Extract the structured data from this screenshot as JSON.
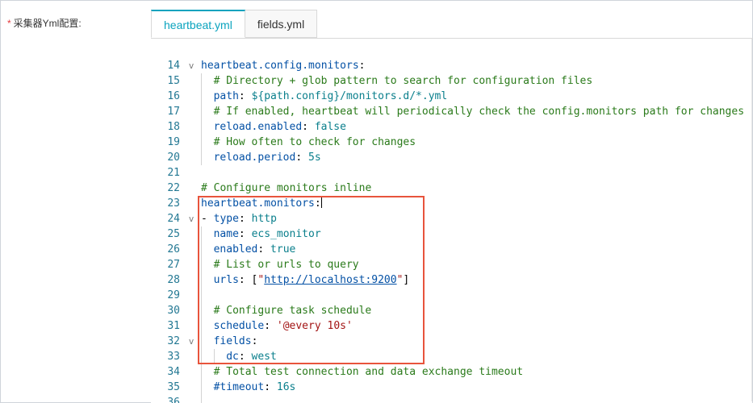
{
  "form": {
    "required_mark": "*",
    "label": "采集器Yml配置:"
  },
  "tabs": [
    {
      "label": "heartbeat.yml",
      "active": true
    },
    {
      "label": "fields.yml",
      "active": false
    }
  ],
  "editor": {
    "lines": [
      {
        "n": "14",
        "fold": "v",
        "indent": 0,
        "tokens": [
          {
            "t": "k",
            "v": "heartbeat.config.monitors"
          },
          {
            "t": "p",
            "v": ":"
          }
        ]
      },
      {
        "n": "15",
        "fold": "",
        "indent": 1,
        "tokens": [
          {
            "t": "c",
            "v": "# Directory + glob pattern to search for configuration files"
          }
        ]
      },
      {
        "n": "16",
        "fold": "",
        "indent": 1,
        "tokens": [
          {
            "t": "k",
            "v": "path"
          },
          {
            "t": "p",
            "v": ": "
          },
          {
            "t": "s",
            "v": "${path.config}/monitors.d/*.yml"
          }
        ]
      },
      {
        "n": "17",
        "fold": "",
        "indent": 1,
        "tokens": [
          {
            "t": "c",
            "v": "# If enabled, heartbeat will periodically check the config.monitors path for changes"
          }
        ]
      },
      {
        "n": "18",
        "fold": "",
        "indent": 1,
        "tokens": [
          {
            "t": "k",
            "v": "reload.enabled"
          },
          {
            "t": "p",
            "v": ": "
          },
          {
            "t": "s",
            "v": "false"
          }
        ]
      },
      {
        "n": "19",
        "fold": "",
        "indent": 1,
        "tokens": [
          {
            "t": "c",
            "v": "# How often to check for changes"
          }
        ]
      },
      {
        "n": "20",
        "fold": "",
        "indent": 1,
        "tokens": [
          {
            "t": "k",
            "v": "reload.period"
          },
          {
            "t": "p",
            "v": ": "
          },
          {
            "t": "s",
            "v": "5s"
          }
        ]
      },
      {
        "n": "21",
        "fold": "",
        "indent": 0,
        "tokens": []
      },
      {
        "n": "22",
        "fold": "",
        "indent": 0,
        "tokens": [
          {
            "t": "c",
            "v": "# Configure monitors inline"
          }
        ]
      },
      {
        "n": "23",
        "fold": "",
        "indent": 0,
        "cursor": true,
        "tokens": [
          {
            "t": "k",
            "v": "heartbeat.monitors"
          },
          {
            "t": "p",
            "v": ":"
          }
        ]
      },
      {
        "n": "24",
        "fold": "v",
        "indent": 0,
        "tokens": [
          {
            "t": "p",
            "v": "- "
          },
          {
            "t": "k",
            "v": "type"
          },
          {
            "t": "p",
            "v": ": "
          },
          {
            "t": "s",
            "v": "http"
          }
        ]
      },
      {
        "n": "25",
        "fold": "",
        "indent": 1,
        "tokens": [
          {
            "t": "k",
            "v": "name"
          },
          {
            "t": "p",
            "v": ": "
          },
          {
            "t": "s",
            "v": "ecs_monitor"
          }
        ]
      },
      {
        "n": "26",
        "fold": "",
        "indent": 1,
        "tokens": [
          {
            "t": "k",
            "v": "enabled"
          },
          {
            "t": "p",
            "v": ": "
          },
          {
            "t": "s",
            "v": "true"
          }
        ]
      },
      {
        "n": "27",
        "fold": "",
        "indent": 1,
        "tokens": [
          {
            "t": "c",
            "v": "# List or urls to query"
          }
        ]
      },
      {
        "n": "28",
        "fold": "",
        "indent": 1,
        "tokens": [
          {
            "t": "k",
            "v": "urls"
          },
          {
            "t": "p",
            "v": ": ["
          },
          {
            "t": "sr",
            "v": "\""
          },
          {
            "t": "u",
            "v": "http://localhost:9200"
          },
          {
            "t": "sr",
            "v": "\""
          },
          {
            "t": "p",
            "v": "]"
          }
        ]
      },
      {
        "n": "29",
        "fold": "",
        "indent": 1,
        "tokens": []
      },
      {
        "n": "30",
        "fold": "",
        "indent": 1,
        "tokens": [
          {
            "t": "c",
            "v": "# Configure task schedule"
          }
        ]
      },
      {
        "n": "31",
        "fold": "",
        "indent": 1,
        "tokens": [
          {
            "t": "k",
            "v": "schedule"
          },
          {
            "t": "p",
            "v": ": "
          },
          {
            "t": "sr",
            "v": "'@every 10s'"
          }
        ]
      },
      {
        "n": "32",
        "fold": "v",
        "indent": 1,
        "tokens": [
          {
            "t": "k",
            "v": "fields"
          },
          {
            "t": "p",
            "v": ":"
          }
        ]
      },
      {
        "n": "33",
        "fold": "",
        "indent": 2,
        "tokens": [
          {
            "t": "k",
            "v": "dc"
          },
          {
            "t": "p",
            "v": ": "
          },
          {
            "t": "s",
            "v": "west"
          }
        ]
      },
      {
        "n": "34",
        "fold": "",
        "indent": 1,
        "tokens": [
          {
            "t": "c",
            "v": "# Total test connection and data exchange timeout"
          }
        ]
      },
      {
        "n": "35",
        "fold": "",
        "indent": 1,
        "tokens": [
          {
            "t": "k",
            "v": "#timeout"
          },
          {
            "t": "p",
            "v": ": "
          },
          {
            "t": "s",
            "v": "16s"
          }
        ]
      },
      {
        "n": "36",
        "fold": "",
        "indent": 1,
        "tokens": []
      }
    ]
  },
  "colors": {
    "accent": "#0aa3be",
    "highlight_box": "#e8543c"
  }
}
